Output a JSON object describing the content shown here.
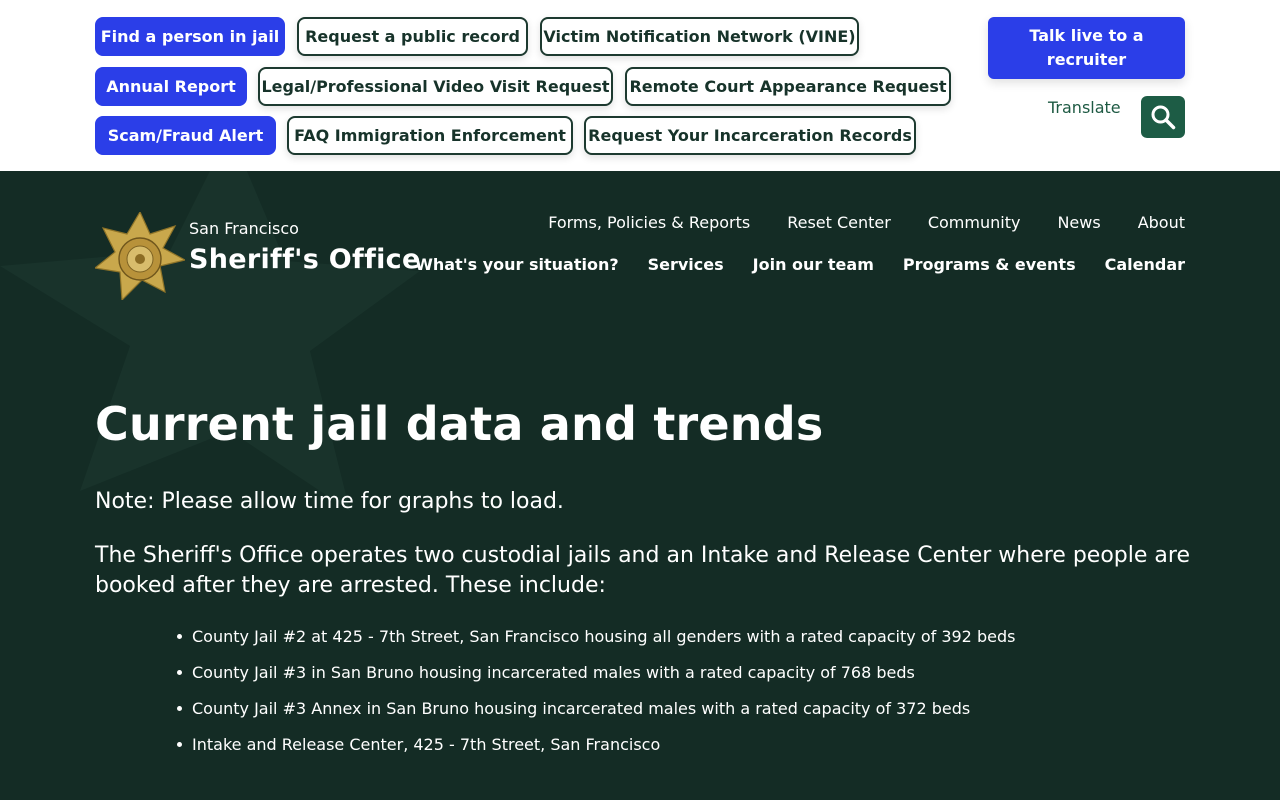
{
  "quick_links": {
    "row1": [
      {
        "label": "Find a person in jail",
        "style": "primary"
      },
      {
        "label": "Request a public record",
        "style": "outline"
      },
      {
        "label": "Victim Notification Network (VINE)",
        "style": "outline"
      }
    ],
    "row2": [
      {
        "label": "Annual Report",
        "style": "primary"
      },
      {
        "label": "Legal/Professional Video Visit Request",
        "style": "outline"
      },
      {
        "label": "Remote Court Appearance Request",
        "style": "outline"
      }
    ],
    "row3": [
      {
        "label": "Scam/Fraud Alert",
        "style": "primary"
      },
      {
        "label": "FAQ Immigration Enforcement",
        "style": "outline"
      },
      {
        "label": "Request Your Incarceration Records",
        "style": "outline"
      }
    ]
  },
  "recruiter_button": "Talk live to a recruiter",
  "translate_label": "Translate",
  "search_icon": "search-icon",
  "org": {
    "city": "San Francisco",
    "name": "Sheriff's Office",
    "logo_icon": "sheriff-badge-icon"
  },
  "nav": {
    "secondary": [
      "Forms, Policies & Reports",
      "Reset Center",
      "Community",
      "News",
      "About"
    ],
    "primary": [
      "What's your situation?",
      "Services",
      "Join our team",
      "Programs & events",
      "Calendar"
    ]
  },
  "content": {
    "title": "Current jail data and trends",
    "note": "Note: Please allow time for graphs to load.",
    "intro": "The Sheriff's Office operates two custodial jails and an Intake and Release Center where people are booked after they are arrested. These include:",
    "facilities": [
      "County Jail #2 at 425 - 7th Street, San Francisco housing all genders with a rated capacity of 392 beds",
      "County Jail #3 in San Bruno housing incarcerated males with a rated capacity of 768 beds",
      "County Jail #3 Annex in San Bruno housing incarcerated males with a rated capacity of 372 beds",
      "Intake and Release Center, 425 - 7th Street, San Francisco"
    ]
  },
  "colors": {
    "primary_blue": "#2b3ee8",
    "hero_green": "#142c25",
    "accent_green": "#1d5c45"
  }
}
